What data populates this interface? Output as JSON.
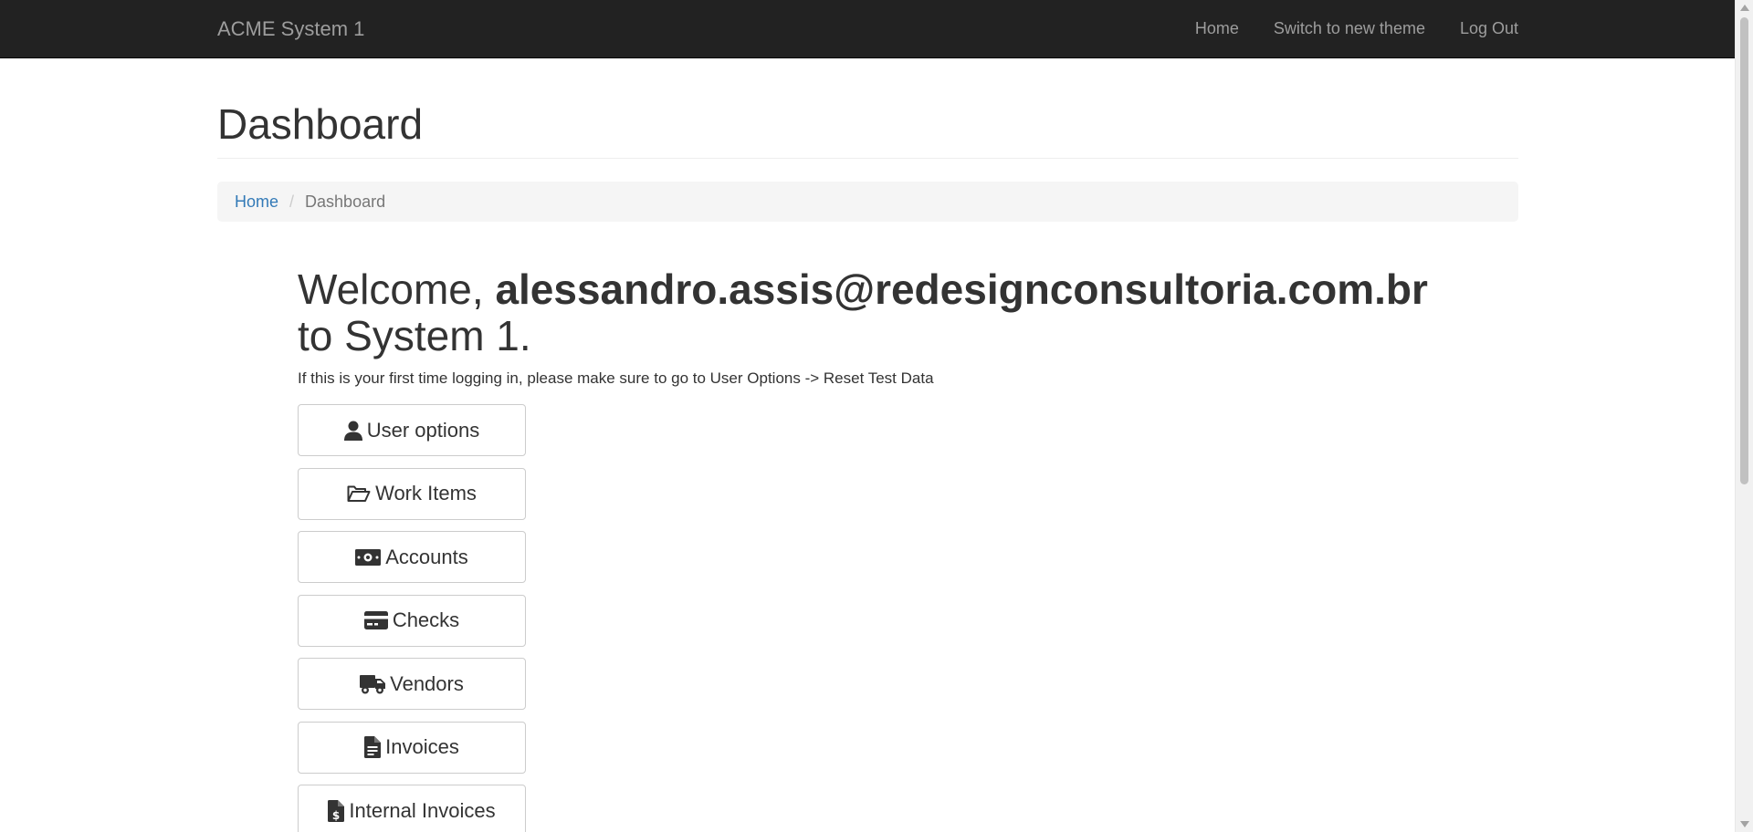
{
  "navbar": {
    "brand": "ACME System 1",
    "links": [
      "Home",
      "Switch to new theme",
      "Log Out"
    ]
  },
  "header": {
    "title": "Dashboard"
  },
  "breadcrumb": {
    "home": "Home",
    "separator": "/",
    "current": "Dashboard"
  },
  "welcome": {
    "prefix": "Welcome,",
    "email": "alessandro.assis@redesignconsultoria.com.br",
    "suffix": "to System 1."
  },
  "instructions": "If this is your first time logging in, please make sure to go to User Options -> Reset Test Data",
  "menu": [
    {
      "label": "User options",
      "icon": "user-icon"
    },
    {
      "label": "Work Items",
      "icon": "folder-open-icon"
    },
    {
      "label": "Accounts",
      "icon": "money-bill-icon"
    },
    {
      "label": "Checks",
      "icon": "credit-card-icon"
    },
    {
      "label": "Vendors",
      "icon": "truck-icon"
    },
    {
      "label": "Invoices",
      "icon": "file-invoice-icon"
    },
    {
      "label": "Internal Invoices",
      "icon": "file-invoice-dollar-icon"
    }
  ],
  "colors": {
    "navbar_bg": "#222222",
    "nav_text": "#9d9d9d",
    "link": "#337ab7",
    "breadcrumb_bg": "#f5f5f5",
    "text": "#333333"
  }
}
